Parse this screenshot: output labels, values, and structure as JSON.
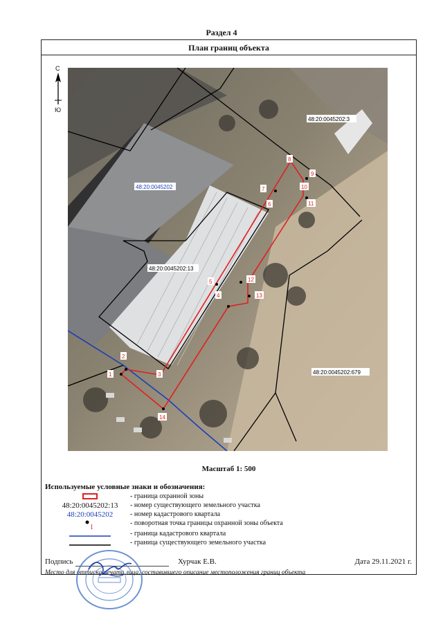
{
  "section_title": "Раздел 4",
  "plan_title": "План границ объекта",
  "compass": {
    "north": "С",
    "south": "Ю"
  },
  "map": {
    "parcel_labels": [
      "48:20:0045202:3",
      "48:20:0045202:13",
      "48:20:0045202:679"
    ],
    "quarter_label": "48:20:0045202",
    "points": [
      "1",
      "2",
      "3",
      "4",
      "5",
      "6",
      "7",
      "8",
      "9",
      "10",
      "11",
      "12",
      "13",
      "14"
    ]
  },
  "scale_text": "Масштаб 1: 500",
  "legend": {
    "title": "Используемые условные знаки и обозначения:",
    "items": [
      {
        "symbol": "",
        "text": "- граница охранной зоны"
      },
      {
        "symbol": "48:20:0045202:13",
        "text": "- номер существующего земельного участка"
      },
      {
        "symbol": "48:20:0045202",
        "text": "- номер кадастрового квартала"
      },
      {
        "symbol": "1",
        "text": "- поворотная точка границы охранной зоны объекта"
      },
      {
        "symbol": "",
        "text": "- граница кадастрового квартала"
      },
      {
        "symbol": "",
        "text": "- граница существующего земельного участка"
      }
    ]
  },
  "footer": {
    "sign_label": "Подпись",
    "signer": "Хурчак Е.В.",
    "date": "Дата 29.11.2021 г.",
    "note": "Место для оттиска печати лица, составившего описание местоположения границ объекта"
  },
  "colors": {
    "zone": "#e02020",
    "quarter": "#1a3fb8",
    "parcel": "#000000"
  }
}
